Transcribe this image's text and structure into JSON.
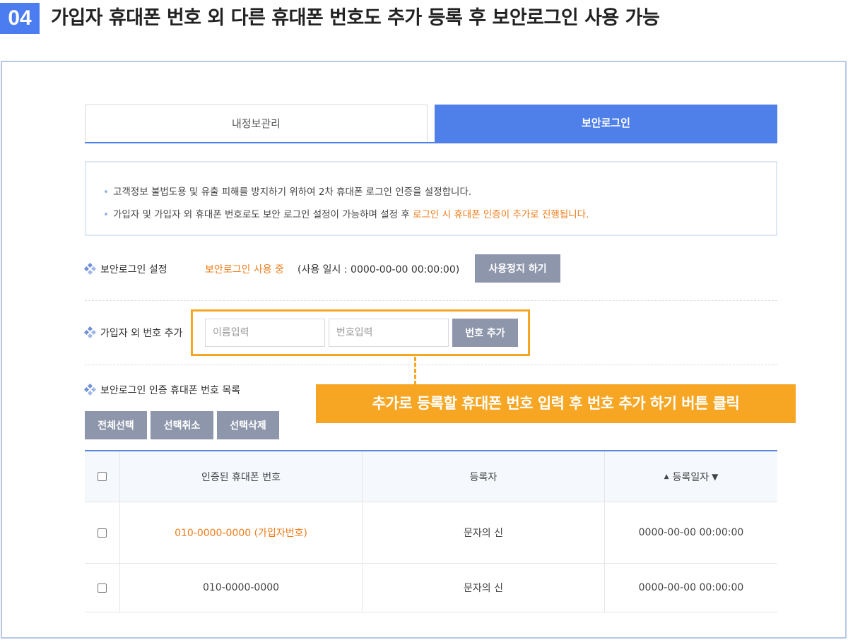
{
  "step": {
    "number": "04",
    "title": "가입자 휴대폰 번호 외 다른 휴대폰 번호도 추가 등록 후 보안로그인 사용 가능"
  },
  "tabs": [
    {
      "label": "내정보관리",
      "active": false
    },
    {
      "label": "보안로그인",
      "active": true
    }
  ],
  "notice": {
    "bullet": "•",
    "line1": "고객정보 불법도용 및 유출 피해를 방지하기 위하여 2차 휴대폰 로그인 인증을 설정합니다.",
    "line2_prefix": "가입자 및 가입자 외 휴대폰 번호로도 보안 로그인 설정이 가능하며 설정 후 ",
    "line2_highlight": "로그인 시 휴대폰 인증이 추가로 진행됩니다."
  },
  "secure_login": {
    "label": "보안로그인 설정",
    "status": "보안로그인 사용 중",
    "since": "(사용 일시 : 0000-00-00 00:00:00)",
    "stop_button": "사용정지 하기"
  },
  "add_number": {
    "label": "가입자 외 번호 추가",
    "name_placeholder": "이름입력",
    "number_placeholder": "번호입력",
    "add_button": "번호 추가"
  },
  "callout": "추가로 등록할 휴대폰 번호 입력 후 번호 추가 하기 버튼 클릭",
  "list": {
    "label": "보안로그인 인증 휴대폰 번호 목록",
    "select_all": "전체선택",
    "deselect": "선택취소",
    "delete_selected": "선택삭제"
  },
  "table": {
    "headers": [
      "인증된 휴대폰 번호",
      "등록자",
      "등록일자"
    ],
    "sort_up": "▲",
    "sort_down": "▼",
    "rows": [
      {
        "number": "010-0000-0000 (가입자번호)",
        "registrant": "문자의 신",
        "date": "0000-00-00 00:00:00",
        "is_owner": true
      },
      {
        "number": "010-0000-0000",
        "registrant": "문자의 신",
        "date": "0000-00-00 00:00:00",
        "is_owner": false
      }
    ]
  },
  "colors": {
    "accent": "#4f80ea",
    "highlight": "#f5a623",
    "status_orange": "#f07c1a",
    "button_gray": "#8e96ab"
  }
}
